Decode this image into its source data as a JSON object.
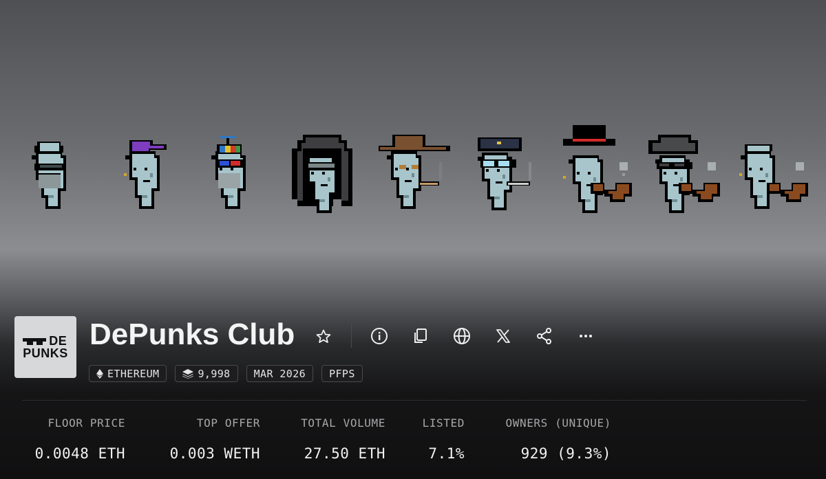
{
  "collection": {
    "name": "DePunks Club",
    "logo": {
      "line1": "DE",
      "line2": "PUNKS"
    }
  },
  "actions": [
    {
      "name": "favorite-star-icon",
      "icon": "star-outline"
    },
    {
      "name": "info-icon",
      "icon": "info-circle"
    },
    {
      "name": "copy-icon",
      "icon": "copy"
    },
    {
      "name": "website-globe-icon",
      "icon": "globe"
    },
    {
      "name": "x-social-icon",
      "icon": "x-logo"
    },
    {
      "name": "share-icon",
      "icon": "share-nodes"
    },
    {
      "name": "more-icon",
      "icon": "ellipsis"
    }
  ],
  "tags": {
    "chain": "ETHEREUM",
    "items": "9,998",
    "date": "MAR 2026",
    "category": "PFPS"
  },
  "stats": {
    "floor": {
      "label": "FLOOR PRICE",
      "value": "0.0048 ETH"
    },
    "top_offer": {
      "label": "TOP OFFER",
      "value": "0.003 WETH"
    },
    "volume": {
      "label": "TOTAL VOLUME",
      "value": "27.50 ETH"
    },
    "listed": {
      "label": "LISTED",
      "value": "7.1%"
    },
    "owners": {
      "label": "OWNERS (UNIQUE)",
      "value": "929 (9.3%)"
    }
  },
  "colors": {
    "background": "#111111",
    "punk_skin": "#a7c5cb",
    "outline": "#000000"
  }
}
